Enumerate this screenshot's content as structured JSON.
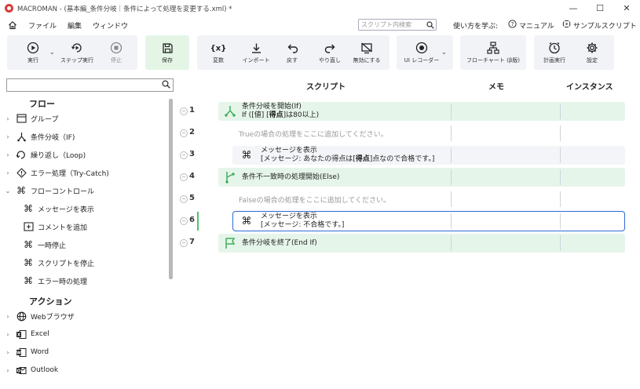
{
  "window": {
    "title": "MACROMAN - (基本編_条件分岐｜条件によって処理を変更する.xml) *",
    "controls": [
      "—",
      "☐",
      "✕"
    ]
  },
  "menu": {
    "items": [
      "ファイル",
      "編集",
      "ウィンドウ"
    ],
    "search_placeholder": "スクリプト内検索",
    "learn_label": "使い方を学ぶ:",
    "manual_label": "マニュアル",
    "samples_label": "サンプルスクリプト"
  },
  "toolbar": {
    "run": "実行",
    "step_run": "ステップ実行",
    "stop": "停止",
    "save": "保存",
    "variables": "変数",
    "import": "インポート",
    "undo": "戻す",
    "redo": "やり直し",
    "disable": "無効にする",
    "ui_recorder": "UI レコーダー",
    "flowchart": "フローチャート (β版)",
    "scheduled_run": "計画実行",
    "settings": "設定"
  },
  "left_panel": {
    "flow_title": "フロー",
    "flow_items": [
      {
        "label": "グループ",
        "icon": "group-icon"
      },
      {
        "label": "条件分岐（IF)",
        "icon": "branch-icon"
      },
      {
        "label": "繰り返し（Loop)",
        "icon": "loop-icon"
      },
      {
        "label": "エラー処理（Try-Catch)",
        "icon": "error-icon"
      },
      {
        "label": "フローコントロール",
        "icon": "command-icon"
      }
    ],
    "flow_control_children": [
      {
        "label": "メッセージを表示",
        "icon": "command-icon"
      },
      {
        "label": "コメントを追加",
        "icon": "comment-icon"
      },
      {
        "label": "一時停止",
        "icon": "command-icon"
      },
      {
        "label": "スクリプトを停止",
        "icon": "command-icon"
      },
      {
        "label": "エラー時の処理",
        "icon": "command-icon"
      }
    ],
    "action_title": "アクション",
    "action_items": [
      {
        "label": "Webブラウザ",
        "icon": "globe-icon"
      },
      {
        "label": "Excel",
        "icon": "excel-icon"
      },
      {
        "label": "Word",
        "icon": "word-icon"
      },
      {
        "label": "Outlook",
        "icon": "outlook-icon"
      }
    ]
  },
  "main": {
    "columns": {
      "script": "スクリプト",
      "memo": "メモ",
      "instance": "インスタンス"
    },
    "rows": [
      {
        "num": "1",
        "line1": "条件分岐を開始(If)",
        "line2_pre": "If ([値] [",
        "line2_bold": "得点",
        "line2_post": "]は80以上)"
      },
      {
        "num": "2",
        "placeholder": "Trueの場合の処理をここに追加してください。"
      },
      {
        "num": "3",
        "line1": "メッセージを表示",
        "line2_pre": "[メッセージ: あなたの得点は[",
        "line2_bold": "得点",
        "line2_post": "]点なので合格です。]"
      },
      {
        "num": "4",
        "line1": "条件不一致時の処理開始(Else)"
      },
      {
        "num": "5",
        "placeholder": "Falseの場合の処理をここに追加してください。"
      },
      {
        "num": "6",
        "line1": "メッセージを表示",
        "line2": "[メッセージ: 不合格です。]"
      },
      {
        "num": "7",
        "line1": "条件分岐を終了(End If)"
      }
    ]
  },
  "colors": {
    "accent_green": "#4cc36a",
    "selection_blue": "#2b6bd6",
    "row_green": "#e6f5ea",
    "logo_red": "#d93a3a"
  }
}
